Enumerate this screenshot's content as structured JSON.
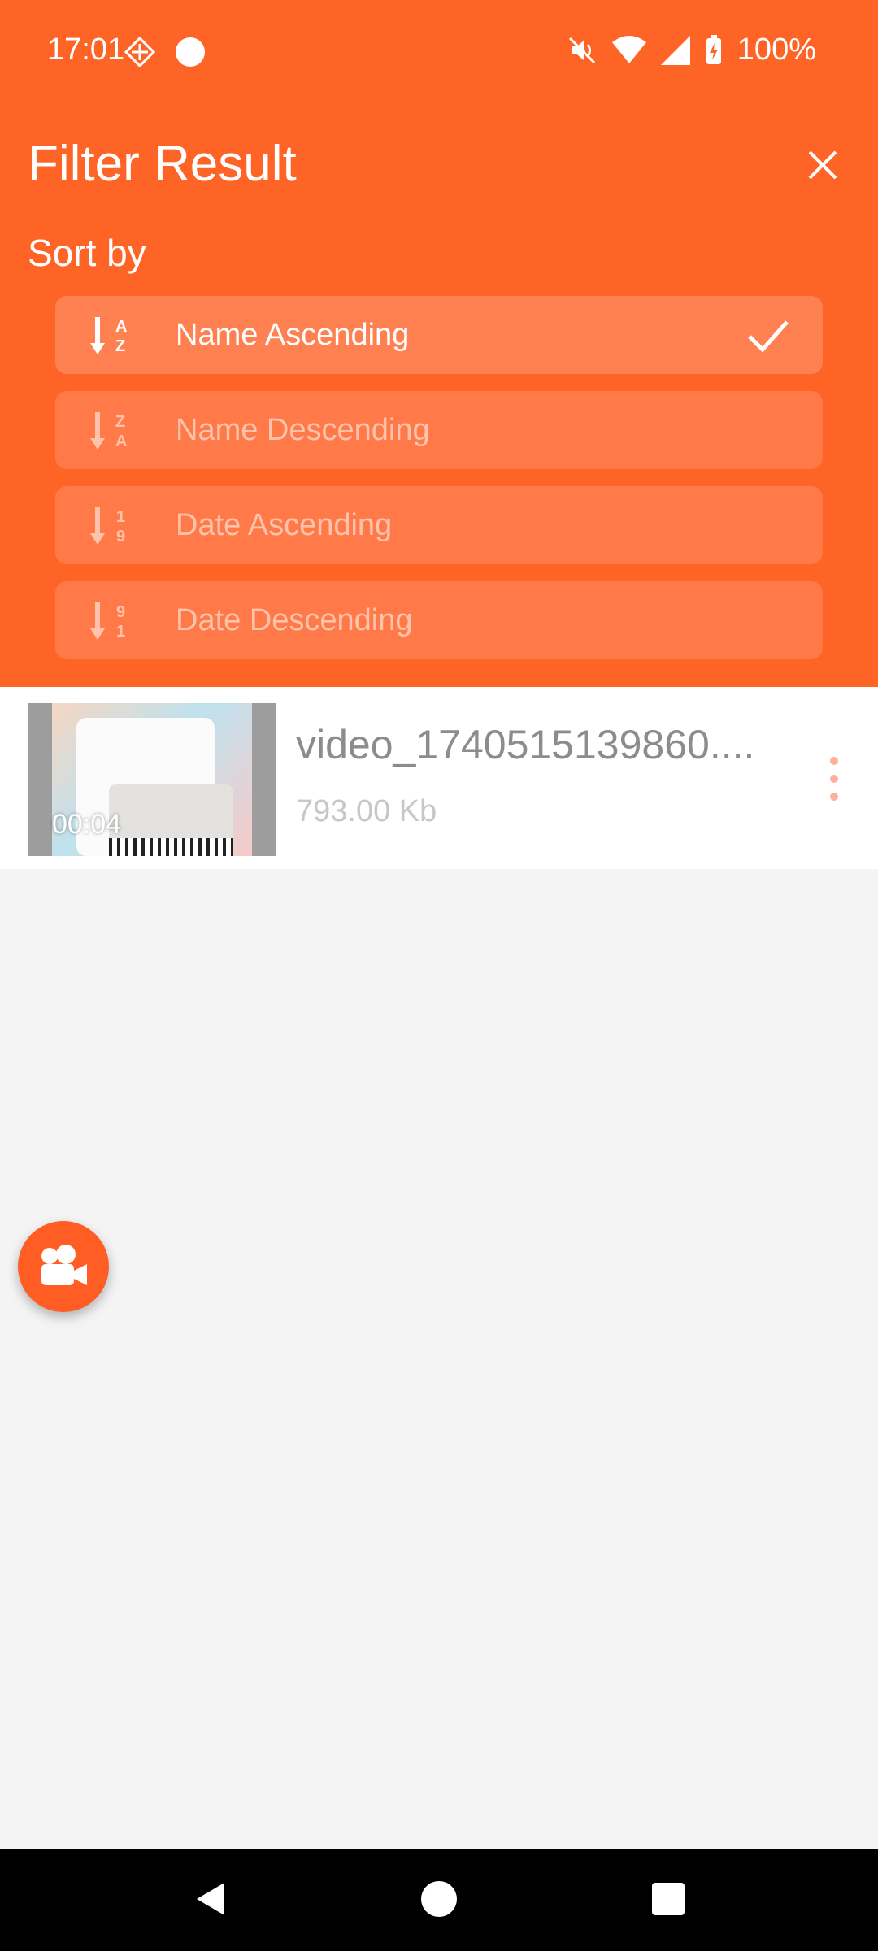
{
  "status_bar": {
    "time": "17:01",
    "battery": "100%",
    "icons": [
      "data-saver-icon",
      "dot-icon",
      "mute-icon",
      "wifi-icon",
      "signal-icon",
      "battery-charging-icon"
    ]
  },
  "filter": {
    "title": "Filter Result",
    "sort_label": "Sort by",
    "options": [
      {
        "label": "Name Ascending",
        "icon": "sort-az-icon",
        "selected": true
      },
      {
        "label": "Name Descending",
        "icon": "sort-za-icon",
        "selected": false
      },
      {
        "label": "Date Ascending",
        "icon": "sort-19-icon",
        "selected": false
      },
      {
        "label": "Date Descending",
        "icon": "sort-91-icon",
        "selected": false
      }
    ]
  },
  "videos": [
    {
      "title": "video_1740515139860....",
      "size": "793.00 Kb",
      "duration": "00:04"
    }
  ],
  "colors": {
    "accent": "#ff6427",
    "fab": "#ff5d24"
  }
}
